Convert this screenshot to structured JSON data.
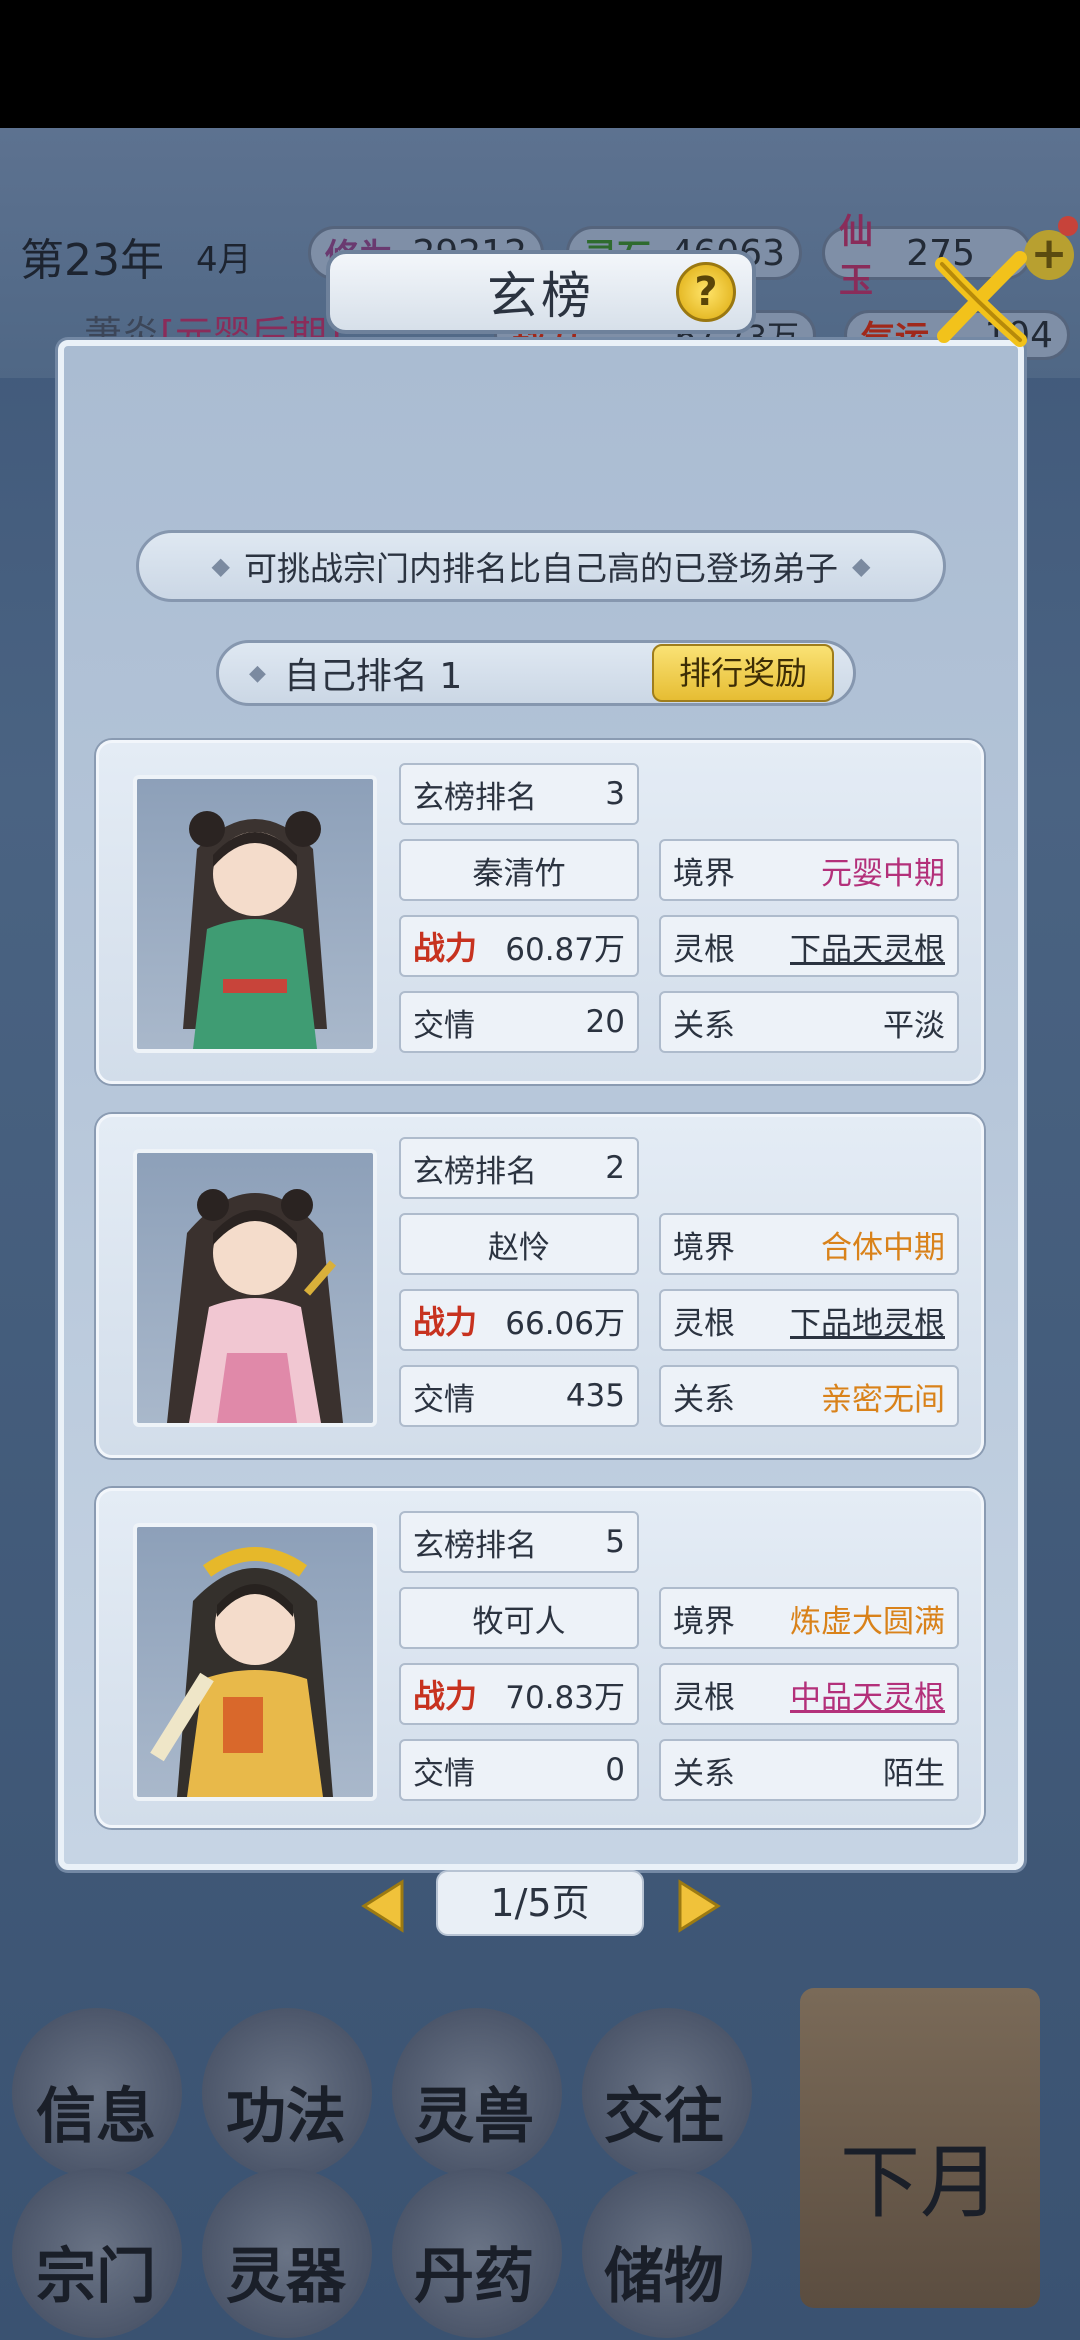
{
  "status": {
    "year": "第23年",
    "month": "4月",
    "resources": [
      {
        "label": "修为",
        "value": "29212",
        "color": "#6a3a70"
      },
      {
        "label": "灵石",
        "value": "46063",
        "color": "#2f6b2f"
      },
      {
        "label": "仙玉",
        "value": "275",
        "color": "#8a2c5a"
      }
    ],
    "player_name": "萧炎",
    "player_realm": "[元婴后期]",
    "power_label": "战力",
    "power_value": "67.73万",
    "luck_label": "气运",
    "luck_value": "104"
  },
  "dialog": {
    "title": "玄榜",
    "hint": "可挑战宗门内排名比自己高的已登场弟子",
    "self_rank": "自己排名 1",
    "reward_button": "排行奖励",
    "page": "1/5页"
  },
  "labels": {
    "rank": "玄榜排名",
    "realm": "境界",
    "power": "战力",
    "root": "灵根",
    "friendship": "交情",
    "relation": "关系"
  },
  "disciples": [
    {
      "rank": "3",
      "name": "秦清竹",
      "realm": "元婴中期",
      "realm_color": "#b3307a",
      "power": "60.87万",
      "root": "下品天灵根",
      "root_color": "#2b3340",
      "friendship": "20",
      "relation": "平淡",
      "relation_color": "#2b3340"
    },
    {
      "rank": "2",
      "name": "赵怜",
      "realm": "合体中期",
      "realm_color": "#d9821a",
      "power": "66.06万",
      "root": "下品地灵根",
      "root_color": "#2b3340",
      "friendship": "435",
      "relation": "亲密无间",
      "relation_color": "#d9821a"
    },
    {
      "rank": "5",
      "name": "牧可人",
      "realm": "炼虚大圆满",
      "realm_color": "#d9821a",
      "power": "70.83万",
      "root": "中品天灵根",
      "root_color": "#b3307a",
      "friendship": "0",
      "relation": "陌生",
      "relation_color": "#2b3340"
    }
  ],
  "menu": {
    "items": [
      "信息",
      "功法",
      "灵兽",
      "交往",
      "宗门",
      "灵器",
      "丹药",
      "储物"
    ],
    "next_month": "下月"
  }
}
